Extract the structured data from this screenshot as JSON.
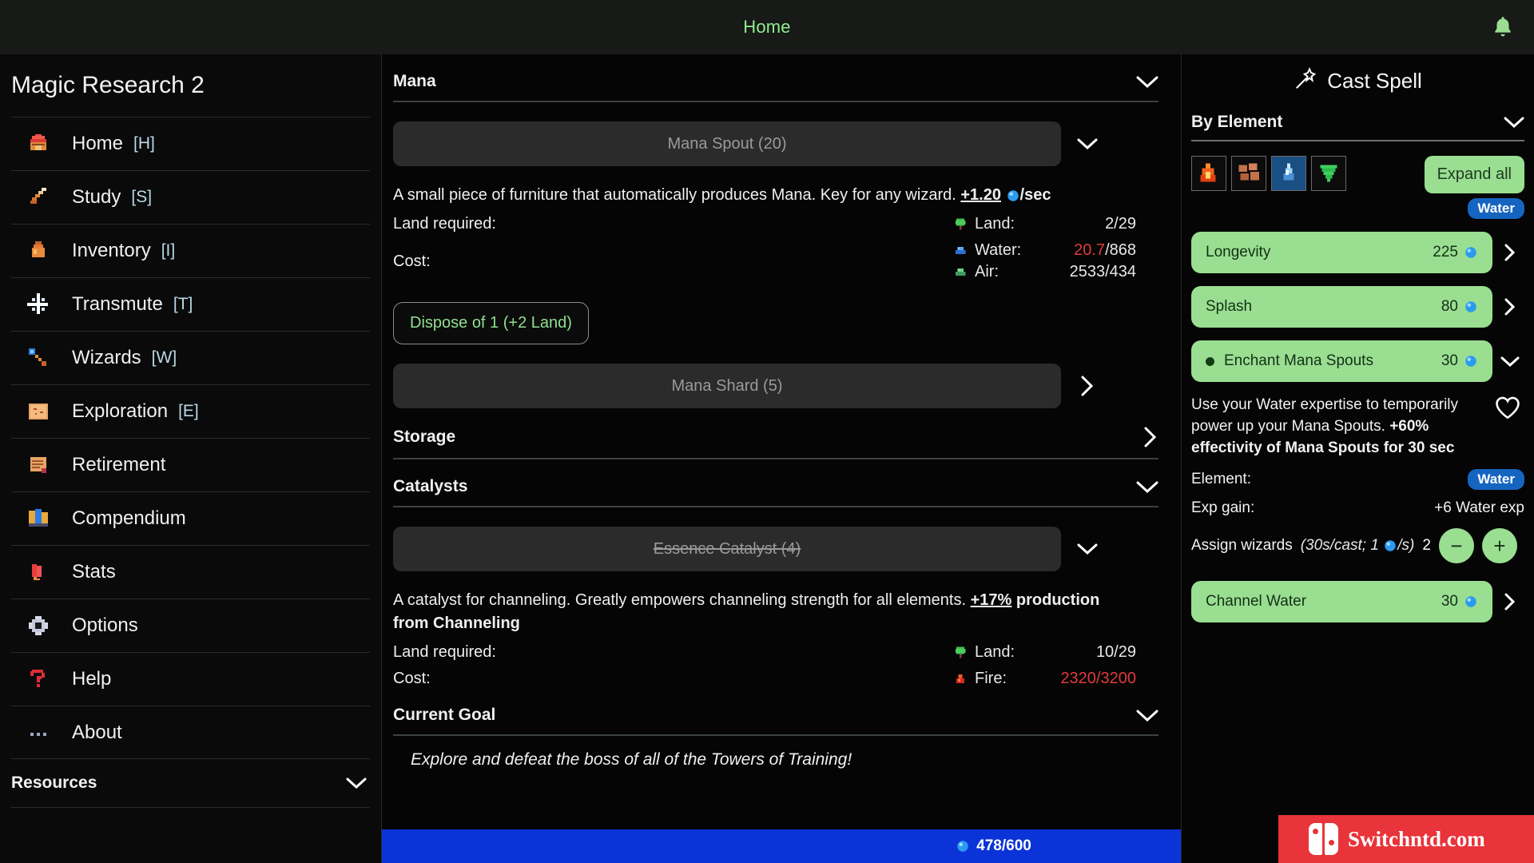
{
  "topbar": {
    "title": "Home",
    "bell_icon": "bell-icon"
  },
  "sidebar": {
    "title": "Magic Research 2",
    "items": [
      {
        "label": "Home",
        "key": "[H]",
        "icon": "house-icon"
      },
      {
        "label": "Study",
        "key": "[S]",
        "icon": "quill-icon"
      },
      {
        "label": "Inventory",
        "key": "[I]",
        "icon": "potion-icon"
      },
      {
        "label": "Transmute",
        "key": "[T]",
        "icon": "sparkle-icon"
      },
      {
        "label": "Wizards",
        "key": "[W]",
        "icon": "wand-icon"
      },
      {
        "label": "Exploration",
        "key": "[E]",
        "icon": "map-icon"
      },
      {
        "label": "Retirement",
        "key": "",
        "icon": "scroll-icon"
      },
      {
        "label": "Compendium",
        "key": "",
        "icon": "books-icon"
      },
      {
        "label": "Stats",
        "key": "",
        "icon": "chart-icon"
      },
      {
        "label": "Options",
        "key": "",
        "icon": "gear-icon"
      },
      {
        "label": "Help",
        "key": "",
        "icon": "question-icon"
      },
      {
        "label": "About",
        "key": "",
        "icon": "ellipsis-icon"
      }
    ],
    "resources": {
      "label": "Resources",
      "chevron": "chevron-down-icon"
    }
  },
  "main": {
    "mana_section": {
      "title": "Mana",
      "chevron": "chevron-down-icon",
      "item": {
        "label": "Mana Spout (20)",
        "caret": "chevron-down-icon",
        "description_pre": "A small piece of furniture that automatically produces Mana. Key for any wizard. ",
        "description_rate": "+1.20",
        "description_post": "/sec",
        "land_required_label": "Land required:",
        "cost_label": "Cost:",
        "stats": [
          {
            "icon": "tree-icon",
            "name": "Land:",
            "value": "2/29",
            "red": false
          },
          {
            "icon": "water-gem-icon",
            "name": "Water:",
            "value": "20.7",
            "value2": "/868",
            "red": true
          },
          {
            "icon": "air-gem-icon",
            "name": "Air:",
            "value": "2533/434",
            "red": false
          }
        ],
        "dispose_label": "Dispose of 1 (+2 Land)"
      },
      "item2": {
        "label": "Mana Shard (5)",
        "caret": "chevron-right-icon"
      }
    },
    "storage_section": {
      "title": "Storage",
      "chevron": "chevron-right-icon"
    },
    "catalysts_section": {
      "title": "Catalysts",
      "chevron": "chevron-down-icon",
      "item": {
        "label": "Essence Catalyst (4)",
        "caret": "chevron-down-icon",
        "description_pre": "A catalyst for channeling. Greatly empowers channeling strength for all elements. ",
        "description_pct": "+17%",
        "description_post": " production from Channeling",
        "land_required_label": "Land required:",
        "cost_label": "Cost:",
        "land": {
          "icon": "tree-icon",
          "name": "Land:",
          "value": "10/29"
        },
        "fire": {
          "icon": "fire-gem-icon",
          "name": "Fire:",
          "value": "2320",
          "value2": "/3200"
        }
      }
    },
    "goal_section": {
      "title": "Current Goal",
      "chevron": "chevron-down-icon",
      "text": "Explore and defeat the boss of all of the Towers of Training!"
    },
    "mana_bar": {
      "icon": "mana-orb-icon",
      "value": "478/600"
    }
  },
  "right": {
    "cast_title": "Cast Spell",
    "cast_icon": "wand-star-icon",
    "by_element": {
      "label": "By Element",
      "chevron": "chevron-down-icon"
    },
    "element_icons": [
      {
        "name": "fire-element-icon",
        "glyph": "🔥"
      },
      {
        "name": "earth-element-icon",
        "glyph": "🧱"
      },
      {
        "name": "water-element-icon",
        "glyph": "💧"
      },
      {
        "name": "air-element-icon",
        "glyph": "🌀"
      }
    ],
    "expand_all": "Expand all",
    "element_pill": "Water",
    "spells": [
      {
        "name": "Longevity",
        "cost": "225",
        "caret": "chevron-right-icon",
        "selected": false
      },
      {
        "name": "Splash",
        "cost": "80",
        "caret": "chevron-right-icon",
        "selected": false
      },
      {
        "name": "Enchant Mana Spouts",
        "cost": "30",
        "caret": "chevron-down-icon",
        "selected": true
      }
    ],
    "detail": {
      "desc_pre": "Use your Water expertise to temporarily power up your Mana Spouts. ",
      "desc_bold": "+60% effectivity of Mana Spouts for 30 sec",
      "favorite_icon": "heart-icon",
      "element_label": "Element:",
      "element_value": "Water",
      "exp_label": "Exp gain:",
      "exp_value": "+6 Water exp",
      "assign_label": "Assign wizards",
      "assign_hint_pre": "(30s/cast; 1",
      "assign_hint_post": "/s)",
      "assign_count": "2",
      "minus_label": "−",
      "plus_label": "+"
    },
    "spell_last": {
      "name": "Channel Water",
      "cost": "30",
      "caret": "chevron-right-icon"
    }
  },
  "watermark": {
    "text": "Switchntd.com"
  },
  "colors": {
    "accent_green": "#9ade92",
    "water_blue": "#1565c0",
    "mana_bar_blue": "#0b34d8",
    "red": "#e03b3b",
    "title_green": "#90ee90"
  }
}
